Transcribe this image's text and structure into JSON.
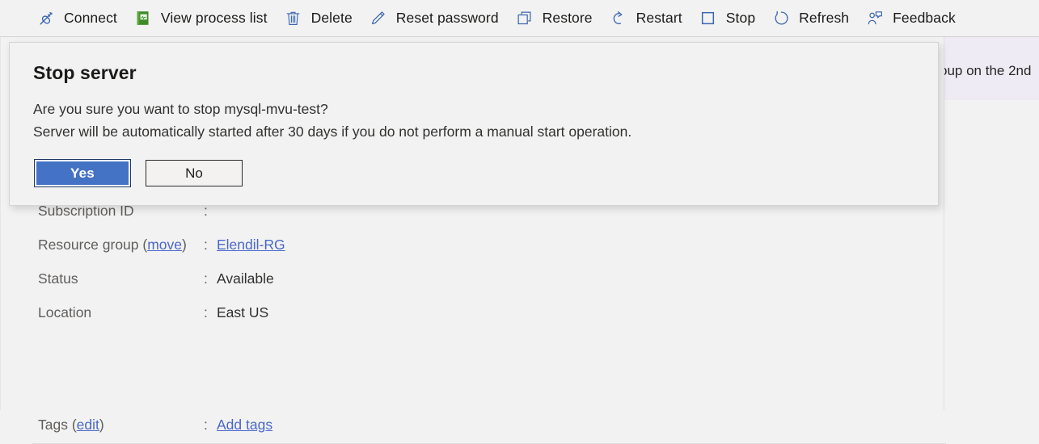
{
  "commandbar": {
    "items": [
      {
        "label": "Connect",
        "icon": "connect-plug-icon"
      },
      {
        "label": "View process list",
        "icon": "process-list-book-icon"
      },
      {
        "label": "Delete",
        "icon": "trash-icon"
      },
      {
        "label": "Reset password",
        "icon": "pencil-icon"
      },
      {
        "label": "Restore",
        "icon": "restore-windows-icon"
      },
      {
        "label": "Restart",
        "icon": "restart-arrow-icon"
      },
      {
        "label": "Stop",
        "icon": "stop-square-icon"
      },
      {
        "label": "Refresh",
        "icon": "refresh-circle-icon"
      },
      {
        "label": "Feedback",
        "icon": "feedback-person-icon"
      }
    ]
  },
  "notice": {
    "text": "oup on the 2nd"
  },
  "dialog": {
    "title": "Stop server",
    "line1": "Are you sure you want to stop mysql-mvu-test?",
    "line2": "Server will be automatically started after 30 days if you do not perform a manual start operation.",
    "confirm_label": "Yes",
    "cancel_label": "No"
  },
  "properties": {
    "rows": [
      {
        "key": "Subscription ID",
        "colon": ":",
        "value": ""
      },
      {
        "key_prefix": "Resource group (",
        "key_link": "move",
        "key_suffix": ")",
        "colon": ":",
        "value_link": "Elendil-RG"
      },
      {
        "key": "Status",
        "colon": ":",
        "value": "Available"
      },
      {
        "key": "Location",
        "colon": ":",
        "value": "East US"
      }
    ],
    "tags": {
      "key_prefix": "Tags (",
      "key_link": "edit",
      "key_suffix": ")",
      "colon": ":",
      "value_link": "Add tags"
    }
  },
  "colors": {
    "accent_blue": "#4472c4",
    "icon_blue": "#3a66b0",
    "link_blue": "#4a68c8",
    "page_bg": "#f2f2f2",
    "notice_bg": "#eeebf4"
  }
}
